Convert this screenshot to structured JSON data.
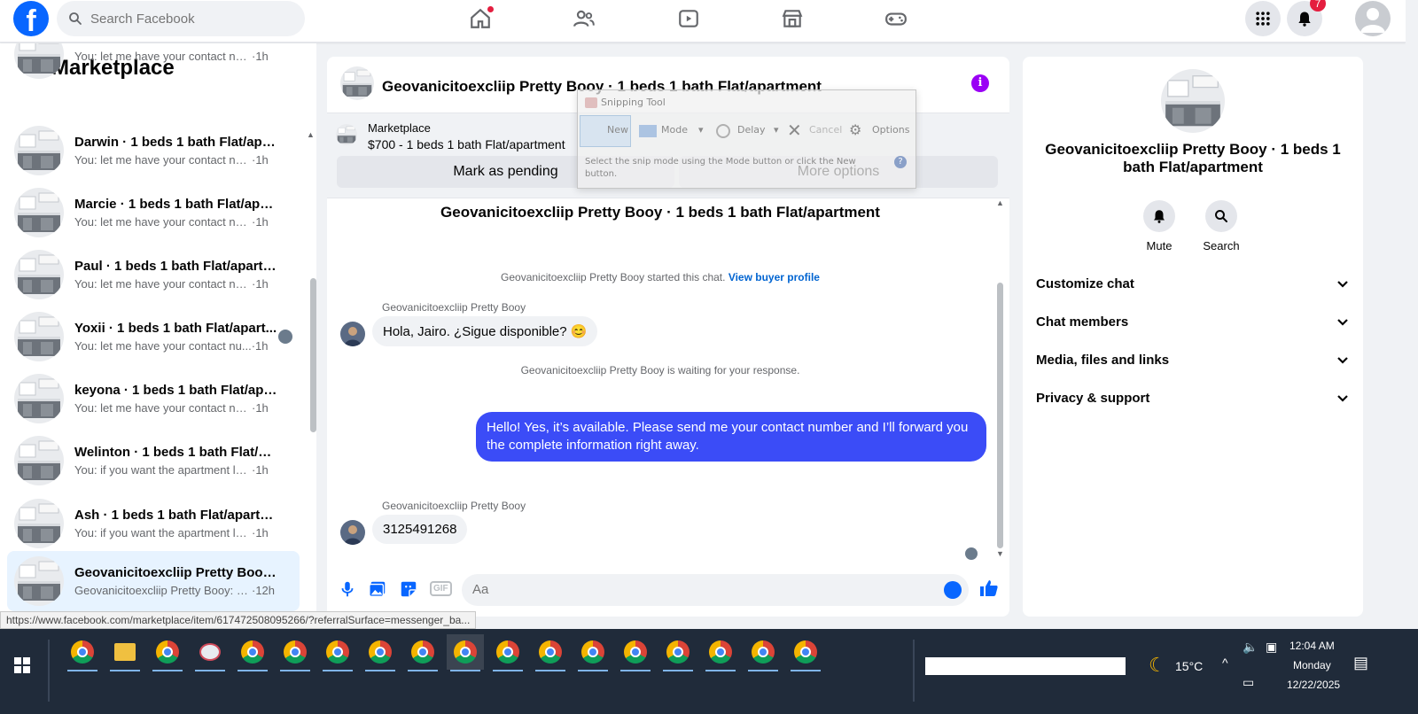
{
  "topbar": {
    "logo": "f",
    "search_placeholder": "Search Facebook",
    "notifications_count": "7"
  },
  "sidebar": {
    "title": "Marketplace",
    "conversations": [
      {
        "title": "",
        "message": "You: let me have your contact num...",
        "time": "·1h"
      },
      {
        "title": "Darwin · 1 beds 1 bath Flat/apart...",
        "message": "You: let me have your contact num...",
        "time": "·1h"
      },
      {
        "title": "Marcie · 1 beds 1 bath Flat/apart...",
        "message": "You: let me have your contact num...",
        "time": "·1h"
      },
      {
        "title": "Paul · 1 beds 1 bath Flat/apartme...",
        "message": "You: let me have your contact num...",
        "time": "·1h"
      },
      {
        "title": "Yoxii · 1 beds 1 bath Flat/apart...",
        "message": "You: let me have your contact nu...",
        "time": "·1h"
      },
      {
        "title": "keyona · 1 beds 1 bath Flat/apart...",
        "message": "You: let me have your contact num...",
        "time": "·1h"
      },
      {
        "title": "Welinton · 1 beds 1 bath Flat/ap...",
        "message": "You: if you want the apartment let ...",
        "time": "·1h"
      },
      {
        "title": "Ash · 1 beds 1 bath Flat/apartment",
        "message": "You: if you want the apartment let ...",
        "time": "·1h"
      },
      {
        "title": "Geovanicitoexcliip Pretty Booy · ...",
        "message": "Geovanicitoexcliip Pretty Booy: 31...",
        "time": "·12h"
      }
    ]
  },
  "chat": {
    "title": "Geovanicitoexcliip Pretty Booy · 1 beds 1 bath Flat/apartment",
    "info_icon": "i",
    "listing": {
      "label": "Marketplace",
      "price_title": "$700 - 1 beds 1 bath Flat/apartment",
      "mark_pending": "Mark as pending",
      "more_options": "More options"
    },
    "center_title": "Geovanicitoexcliip Pretty Booy · 1 beds 1 bath Flat/apartment",
    "started_text": "Geovanicitoexcliip Pretty Booy started this chat.",
    "view_profile": "View buyer profile",
    "sender_name": "Geovanicitoexcliip Pretty Booy",
    "msg1": "Hola, Jairo. ¿Sigue disponible? 😊",
    "waiting_text": "Geovanicitoexcliip Pretty Booy is waiting for your response.",
    "msg_out": "Hello! Yes, it’s available. Please send me your contact number and I’ll forward you the complete information right away.",
    "msg2": "3125491268",
    "composer_placeholder": "Aa",
    "gif_label": "GIF"
  },
  "snipping_tool": {
    "title": "Snipping Tool",
    "new": "New",
    "mode": "Mode",
    "delay": "Delay",
    "cancel": "Cancel",
    "options": "Options",
    "help": "Select the snip mode using the Mode button or click the New button.",
    "help_icon": "?"
  },
  "right_panel": {
    "title": "Geovanicitoexcliip Pretty Booy · 1 beds 1 bath Flat/apartment",
    "mute": "Mute",
    "search": "Search",
    "sections": [
      "Customize chat",
      "Chat members",
      "Media, files and links",
      "Privacy & support"
    ]
  },
  "status_url": "https://www.facebook.com/marketplace/item/617472508095266/?referralSurface=messenger_ba...",
  "taskbar": {
    "temperature": "15°C",
    "time": "12:04 AM",
    "day": "Monday",
    "date": "12/22/2025"
  }
}
